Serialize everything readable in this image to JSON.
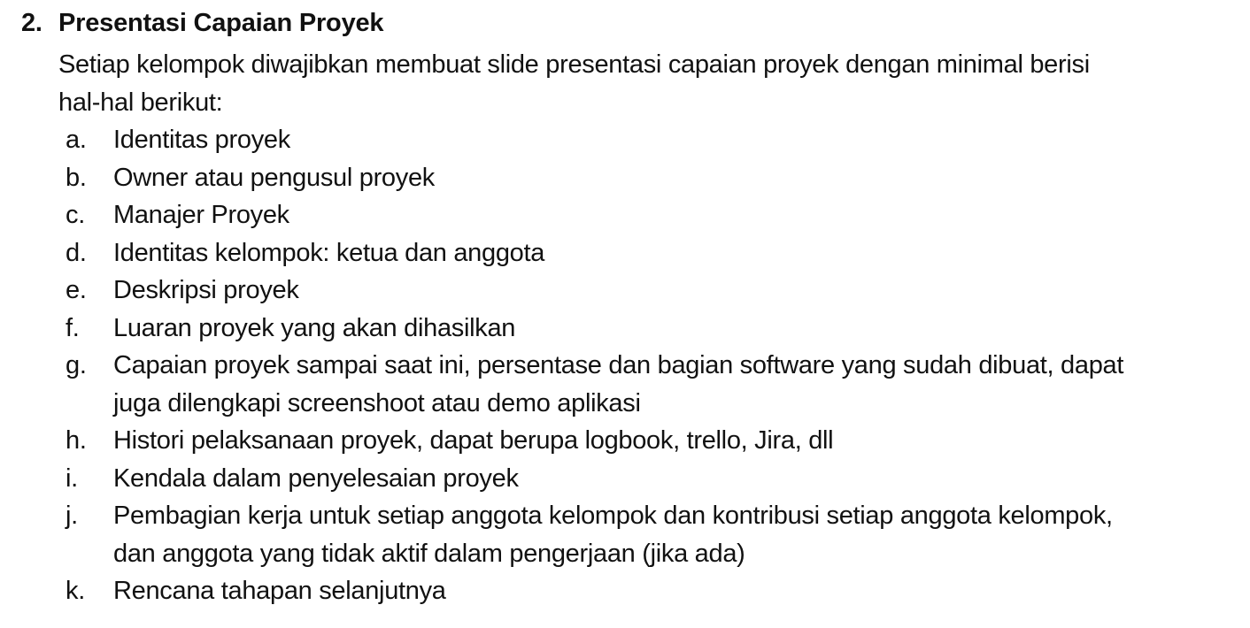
{
  "section": {
    "number": "2.",
    "title": "Presentasi Capaian Proyek",
    "intro": "Setiap kelompok diwajibkan membuat slide presentasi capaian proyek dengan minimal berisi\nhal-hal berikut:"
  },
  "items": [
    {
      "marker": "a.",
      "text": "Identitas proyek"
    },
    {
      "marker": "b.",
      "text": "Owner atau pengusul proyek"
    },
    {
      "marker": "c.",
      "text": "Manajer Proyek"
    },
    {
      "marker": "d.",
      "text": "Identitas kelompok: ketua dan anggota"
    },
    {
      "marker": "e.",
      "text": "Deskripsi proyek"
    },
    {
      "marker": "f.",
      "text": "Luaran proyek yang akan dihasilkan"
    },
    {
      "marker": "g.",
      "text": "Capaian proyek sampai saat ini, persentase dan bagian software yang sudah dibuat, dapat\njuga dilengkapi screenshoot atau demo aplikasi"
    },
    {
      "marker": "h.",
      "text": "Histori pelaksanaan proyek, dapat berupa logbook, trello, Jira, dll"
    },
    {
      "marker": "i.",
      "text": "Kendala dalam penyelesaian proyek"
    },
    {
      "marker": "j.",
      "text": "Pembagian kerja untuk setiap anggota kelompok dan kontribusi setiap anggota kelompok,\ndan anggota yang tidak aktif dalam pengerjaan (jika ada)"
    },
    {
      "marker": "k.",
      "text": "Rencana tahapan selanjutnya"
    }
  ]
}
